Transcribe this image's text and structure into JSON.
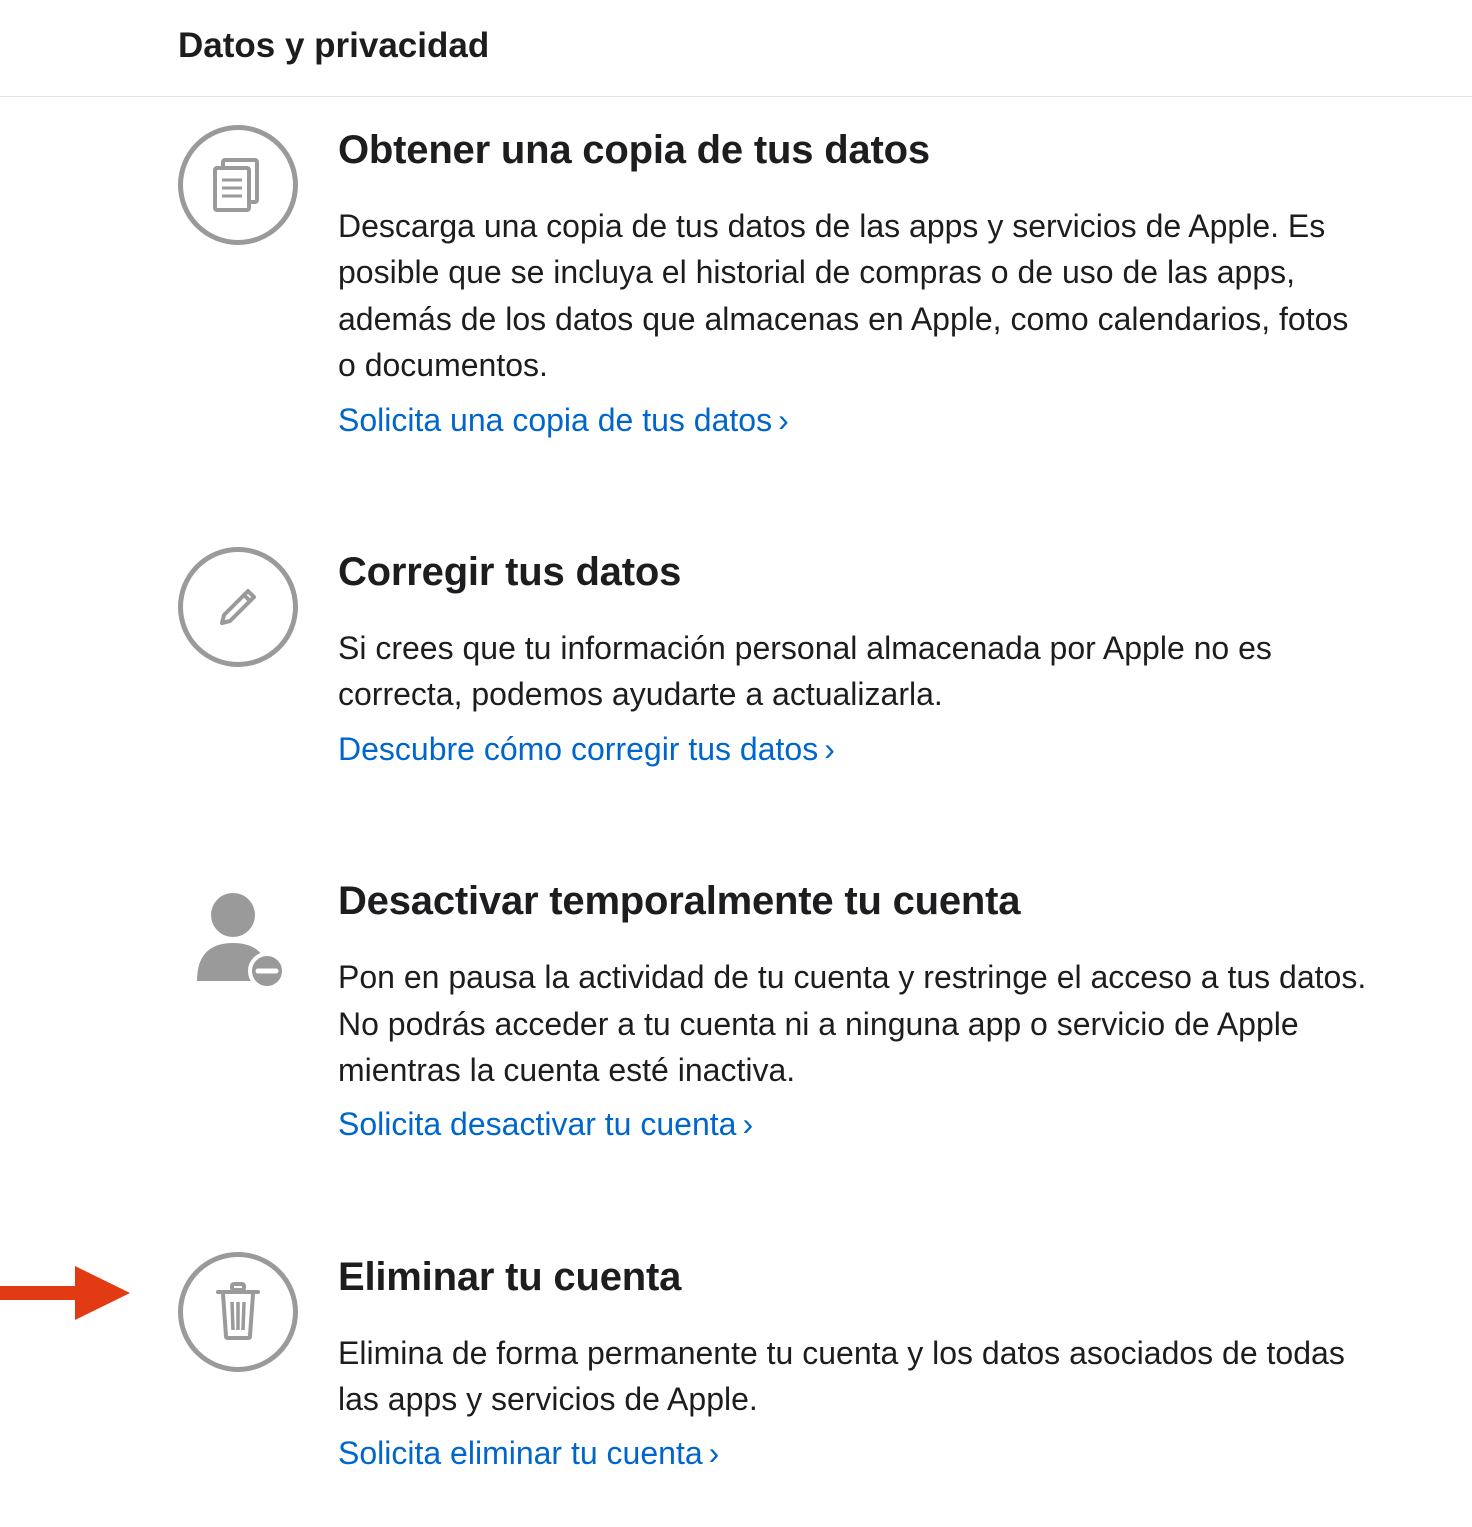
{
  "header": {
    "title": "Datos y privacidad"
  },
  "sections": [
    {
      "icon": "document-copy-icon",
      "title": "Obtener una copia de tus datos",
      "desc": "Descarga una copia de tus datos de las apps y servicios de Apple. Es posible que se incluya el historial de compras o de uso de las apps, además de los datos que almacenas en Apple, como calendarios, fotos o documentos.",
      "link": "Solicita una copia de tus datos"
    },
    {
      "icon": "pencil-icon",
      "title": "Corregir tus datos",
      "desc": "Si crees que tu información personal almacenada por Apple no es correcta, podemos ayudarte a actualizarla.",
      "link": "Descubre cómo corregir tus datos"
    },
    {
      "icon": "person-pause-icon",
      "title": "Desactivar temporalmente tu cuenta",
      "desc": "Pon en pausa la actividad de tu cuenta y restringe el acceso a tus datos. No podrás acceder a tu cuenta ni a ninguna app o servicio de Apple mientras la cuenta esté inactiva.",
      "link": "Solicita desactivar tu cuenta"
    },
    {
      "icon": "trash-icon",
      "title": "Eliminar tu cuenta",
      "desc": "Elimina de forma permanente tu cuenta y los datos asociados de todas las apps y servicios de Apple.",
      "link": "Solicita eliminar tu cuenta",
      "annotated": true
    }
  ],
  "colors": {
    "link": "#0066cc",
    "icon": "#9a9a9a",
    "arrow": "#e23b13"
  }
}
